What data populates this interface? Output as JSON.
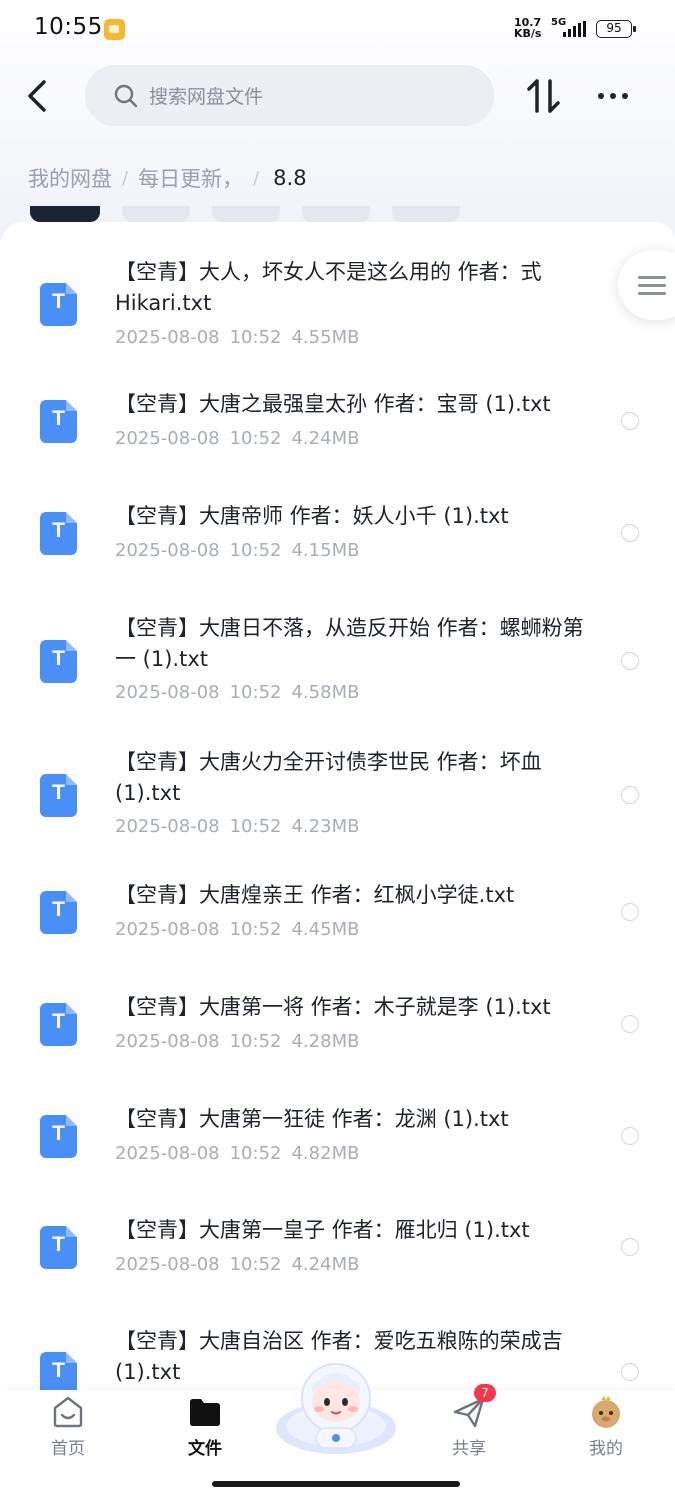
{
  "status_bar": {
    "time": "10:55",
    "net_speed_value": "10.7",
    "net_speed_unit": "KB/s",
    "network": "5G",
    "battery": "95"
  },
  "header": {
    "search_placeholder": "搜索网盘文件"
  },
  "breadcrumb": {
    "root": "我的网盘",
    "folder": "每日更新，",
    "current": "8.8"
  },
  "files": [
    {
      "name": "【空青】大人，坏女人不是这么用的 作者：式Hikari.txt",
      "date": "2025-08-08",
      "time": "10:52",
      "size": "4.55MB",
      "icon_letter": "T"
    },
    {
      "name": "【空青】大唐之最强皇太孙 作者：宝哥 (1).txt",
      "date": "2025-08-08",
      "time": "10:52",
      "size": "4.24MB",
      "icon_letter": "T"
    },
    {
      "name": "【空青】大唐帝师 作者：妖人小千 (1).txt",
      "date": "2025-08-08",
      "time": "10:52",
      "size": "4.15MB",
      "icon_letter": "T"
    },
    {
      "name": "【空青】大唐日不落，从造反开始 作者：螺蛳粉第一 (1).txt",
      "date": "2025-08-08",
      "time": "10:52",
      "size": "4.58MB",
      "icon_letter": "T"
    },
    {
      "name": "【空青】大唐火力全开讨债李世民 作者：坏血(1).txt",
      "date": "2025-08-08",
      "time": "10:52",
      "size": "4.23MB",
      "icon_letter": "T"
    },
    {
      "name": "【空青】大唐煌亲王 作者：红枫小学徒.txt",
      "date": "2025-08-08",
      "time": "10:52",
      "size": "4.45MB",
      "icon_letter": "T"
    },
    {
      "name": "【空青】大唐第一将 作者：木子就是李 (1).txt",
      "date": "2025-08-08",
      "time": "10:52",
      "size": "4.28MB",
      "icon_letter": "T"
    },
    {
      "name": "【空青】大唐第一狂徒 作者：龙渊 (1).txt",
      "date": "2025-08-08",
      "time": "10:52",
      "size": "4.82MB",
      "icon_letter": "T"
    },
    {
      "name": "【空青】大唐第一皇子 作者：雁北归 (1).txt",
      "date": "2025-08-08",
      "time": "10:52",
      "size": "4.24MB",
      "icon_letter": "T"
    },
    {
      "name": "【空青】大唐自治区 作者：爱吃五粮陈的荣成吉(1).txt",
      "date": "",
      "time": "",
      "size": "",
      "icon_letter": "T"
    }
  ],
  "bottom_nav": {
    "home": "首页",
    "files": "文件",
    "share": "共享",
    "share_badge": "7",
    "mine": "我的"
  },
  "icons": {
    "back": "back-arrow-icon",
    "search": "search-icon",
    "sort": "sort-icon",
    "more": "more-dots-icon",
    "file": "txt-file-icon",
    "list_menu": "list-menu-icon"
  },
  "colors": {
    "accent": "#4a8ff5",
    "badge": "#f5374b",
    "text_primary": "#1f2329",
    "text_secondary": "#a9adb5"
  }
}
